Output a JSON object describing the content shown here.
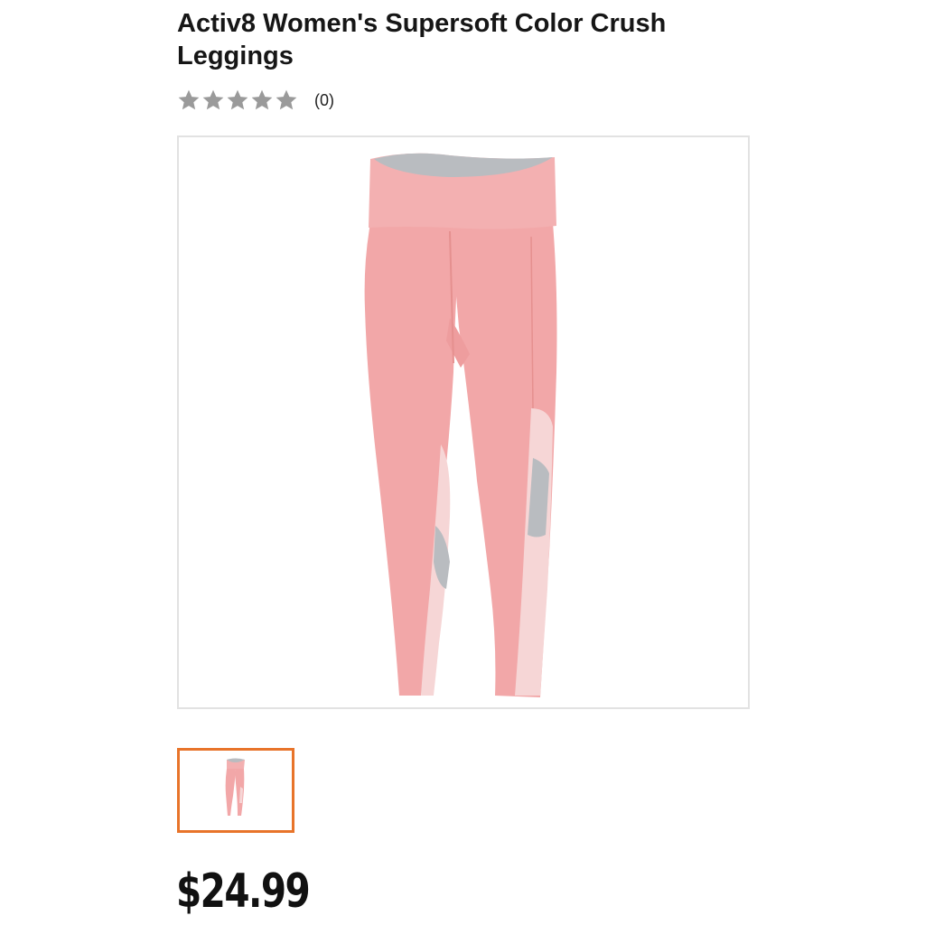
{
  "product": {
    "title": "Activ8 Women's Supersoft Color Crush Leggings",
    "rating": {
      "stars_filled": 0,
      "stars_total": 5,
      "review_count_label": "(0)",
      "star_color": "#9a9a9a"
    },
    "images": {
      "main_icon": "leggings-photo",
      "thumbnails": [
        {
          "icon": "leggings-thumbnail",
          "selected": true
        }
      ],
      "selected_border_color": "#e8742a"
    },
    "price": "$24.99"
  },
  "colors": {
    "legging_pink": "#f2a7a8",
    "legging_gray": "#b9bcc0",
    "legging_light_pink": "#f6d6d6"
  }
}
